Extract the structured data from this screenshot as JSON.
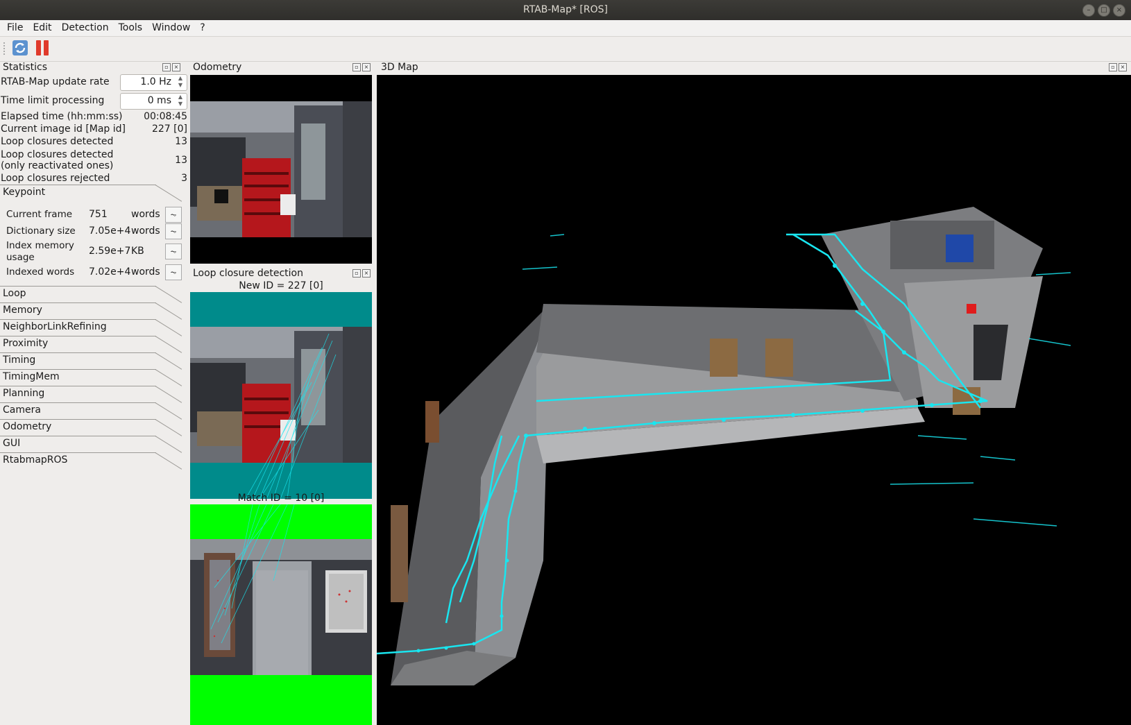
{
  "window": {
    "title": "RTAB-Map* [ROS]"
  },
  "menu": [
    "File",
    "Edit",
    "Detection",
    "Tools",
    "Window",
    "?"
  ],
  "colors": {
    "trajectory": "#19e6f0",
    "teal": "#008b8b",
    "green": "#00ff00"
  },
  "docks": {
    "statistics": "Statistics",
    "odometry": "Odometry",
    "loop_closure": "Loop closure detection",
    "map3d": "3D Map"
  },
  "stats": {
    "update_rate_label": "RTAB-Map update rate",
    "update_rate_value": "1.0 Hz",
    "time_limit_label": "Time limit processing",
    "time_limit_value": "0 ms",
    "rows": [
      {
        "label": "Elapsed time (hh:mm:ss)",
        "value": "00:08:45"
      },
      {
        "label": "Current image id [Map id]",
        "value": "227 [0]"
      },
      {
        "label": "Loop closures detected",
        "value": "13"
      },
      {
        "label": "Loop closures detected\n(only reactivated ones)",
        "value": "13"
      },
      {
        "label": "Loop closures rejected",
        "value": "3"
      }
    ],
    "keypoint": {
      "title": "Keypoint",
      "rows": [
        {
          "label": "Current frame",
          "value": "751",
          "unit": "words"
        },
        {
          "label": "Dictionary size",
          "value": "7.05e+4",
          "unit": "words"
        },
        {
          "label": "Index memory usage",
          "value": "2.59e+7",
          "unit": "KB"
        },
        {
          "label": "Indexed words",
          "value": "7.02e+4",
          "unit": "words"
        }
      ]
    },
    "sections": [
      "Loop",
      "Memory",
      "NeighborLinkRefining",
      "Proximity",
      "Timing",
      "TimingMem",
      "Planning",
      "Camera",
      "Odometry",
      "GUI",
      "RtabmapROS"
    ]
  },
  "loop": {
    "new_id": "New ID = 227 [0]",
    "match_id": "Match ID = 10 [0]"
  }
}
